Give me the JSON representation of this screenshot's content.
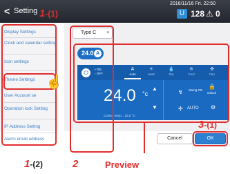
{
  "header": {
    "back_glyph": "<",
    "title": "Setting",
    "datetime": "2016/11/16 Fri. 22:50",
    "message_icon": "U",
    "message_count": "128",
    "alert_icon": "⚠",
    "alert_count": "0"
  },
  "sidebar": {
    "items": [
      "Display Settings",
      "Clock and calendar setting",
      "Icon settings",
      "Theme Settings",
      "User Account se",
      "Operation lock Setting",
      "IP Address Setting",
      "Alarm email address"
    ]
  },
  "main": {
    "type_select": {
      "value": "Type C",
      "caret": "▾"
    }
  },
  "preview_panel": {
    "temp_chip": "24.0",
    "temp_chip_icon": "A",
    "power_glyph": "⏻",
    "on_label": "• ON",
    "off_label": "◦ OFF",
    "modes": [
      {
        "glyph": "A",
        "label": "Auto"
      },
      {
        "glyph": "☀",
        "label": "Heat"
      },
      {
        "glyph": "💧",
        "label": "Dry"
      },
      {
        "glyph": "❄",
        "label": "Cool"
      },
      {
        "glyph": "✤",
        "label": "Fan"
      }
    ],
    "set_temp": "24.0",
    "set_temp_unit": "°c",
    "arrow_up": "▲",
    "arrow_down": "▼",
    "control_temp": "Control temp. : 25.0 °C",
    "swing_glyph": "↯",
    "swing_label": "Swing ON",
    "lock_glyph": "🔒",
    "lock_label": "unlock",
    "fan_glyph": "✣",
    "fan_label": "AUTO",
    "gear_glyph": "⚙"
  },
  "buttons": {
    "cancel": "Cancel",
    "ok": "OK"
  },
  "annotations": {
    "label_1_1_num": "1",
    "label_1_1_sub": "-(1)",
    "label_1_2_num": "1",
    "label_1_2_sub": "-(2)",
    "label_2": "2",
    "label_3_1_num": "3",
    "label_3_1_sub": "-(1)",
    "preview_label": "Preview"
  },
  "colors": {
    "accent": "#1a6ac2",
    "annotation": "#e02d2d",
    "header": "#2b2e35",
    "link": "#3d7ec5"
  }
}
